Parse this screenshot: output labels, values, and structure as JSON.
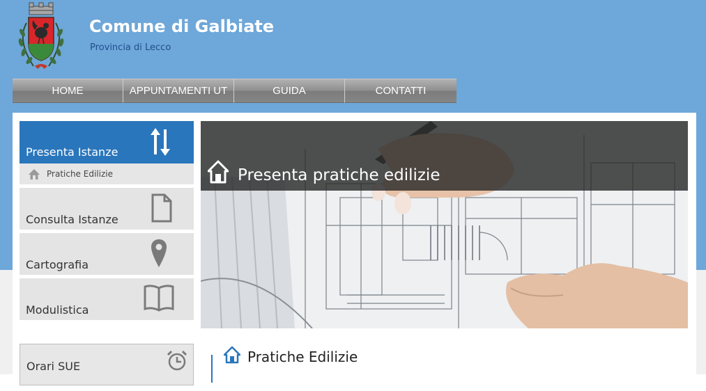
{
  "header": {
    "title": "Comune di Galbiate",
    "subtitle": "Provincia di Lecco"
  },
  "nav": {
    "items": [
      "HOME",
      "APPUNTAMENTI UT",
      "GUIDA",
      "CONTATTI"
    ]
  },
  "sidebar": {
    "active": {
      "label": "Presenta Istanze",
      "icon": "up-down-arrows-icon"
    },
    "sub": {
      "label": "Pratiche Edilizie",
      "icon": "home-icon"
    },
    "items": [
      {
        "label": "Consulta Istanze",
        "icon": "document-icon"
      },
      {
        "label": "Cartografia",
        "icon": "map-pin-icon"
      },
      {
        "label": "Modulistica",
        "icon": "open-book-icon"
      }
    ],
    "box": {
      "label": "Orari SUE",
      "icon": "alarm-clock-icon"
    }
  },
  "hero": {
    "title": "Presenta pratiche edilizie",
    "icon": "home-icon"
  },
  "section": {
    "title": "Pratiche Edilizie",
    "icon": "home-icon"
  },
  "colors": {
    "header_bg": "#6ea7d9",
    "accent": "#2a76bc",
    "subtitle": "#1f4f8c"
  }
}
